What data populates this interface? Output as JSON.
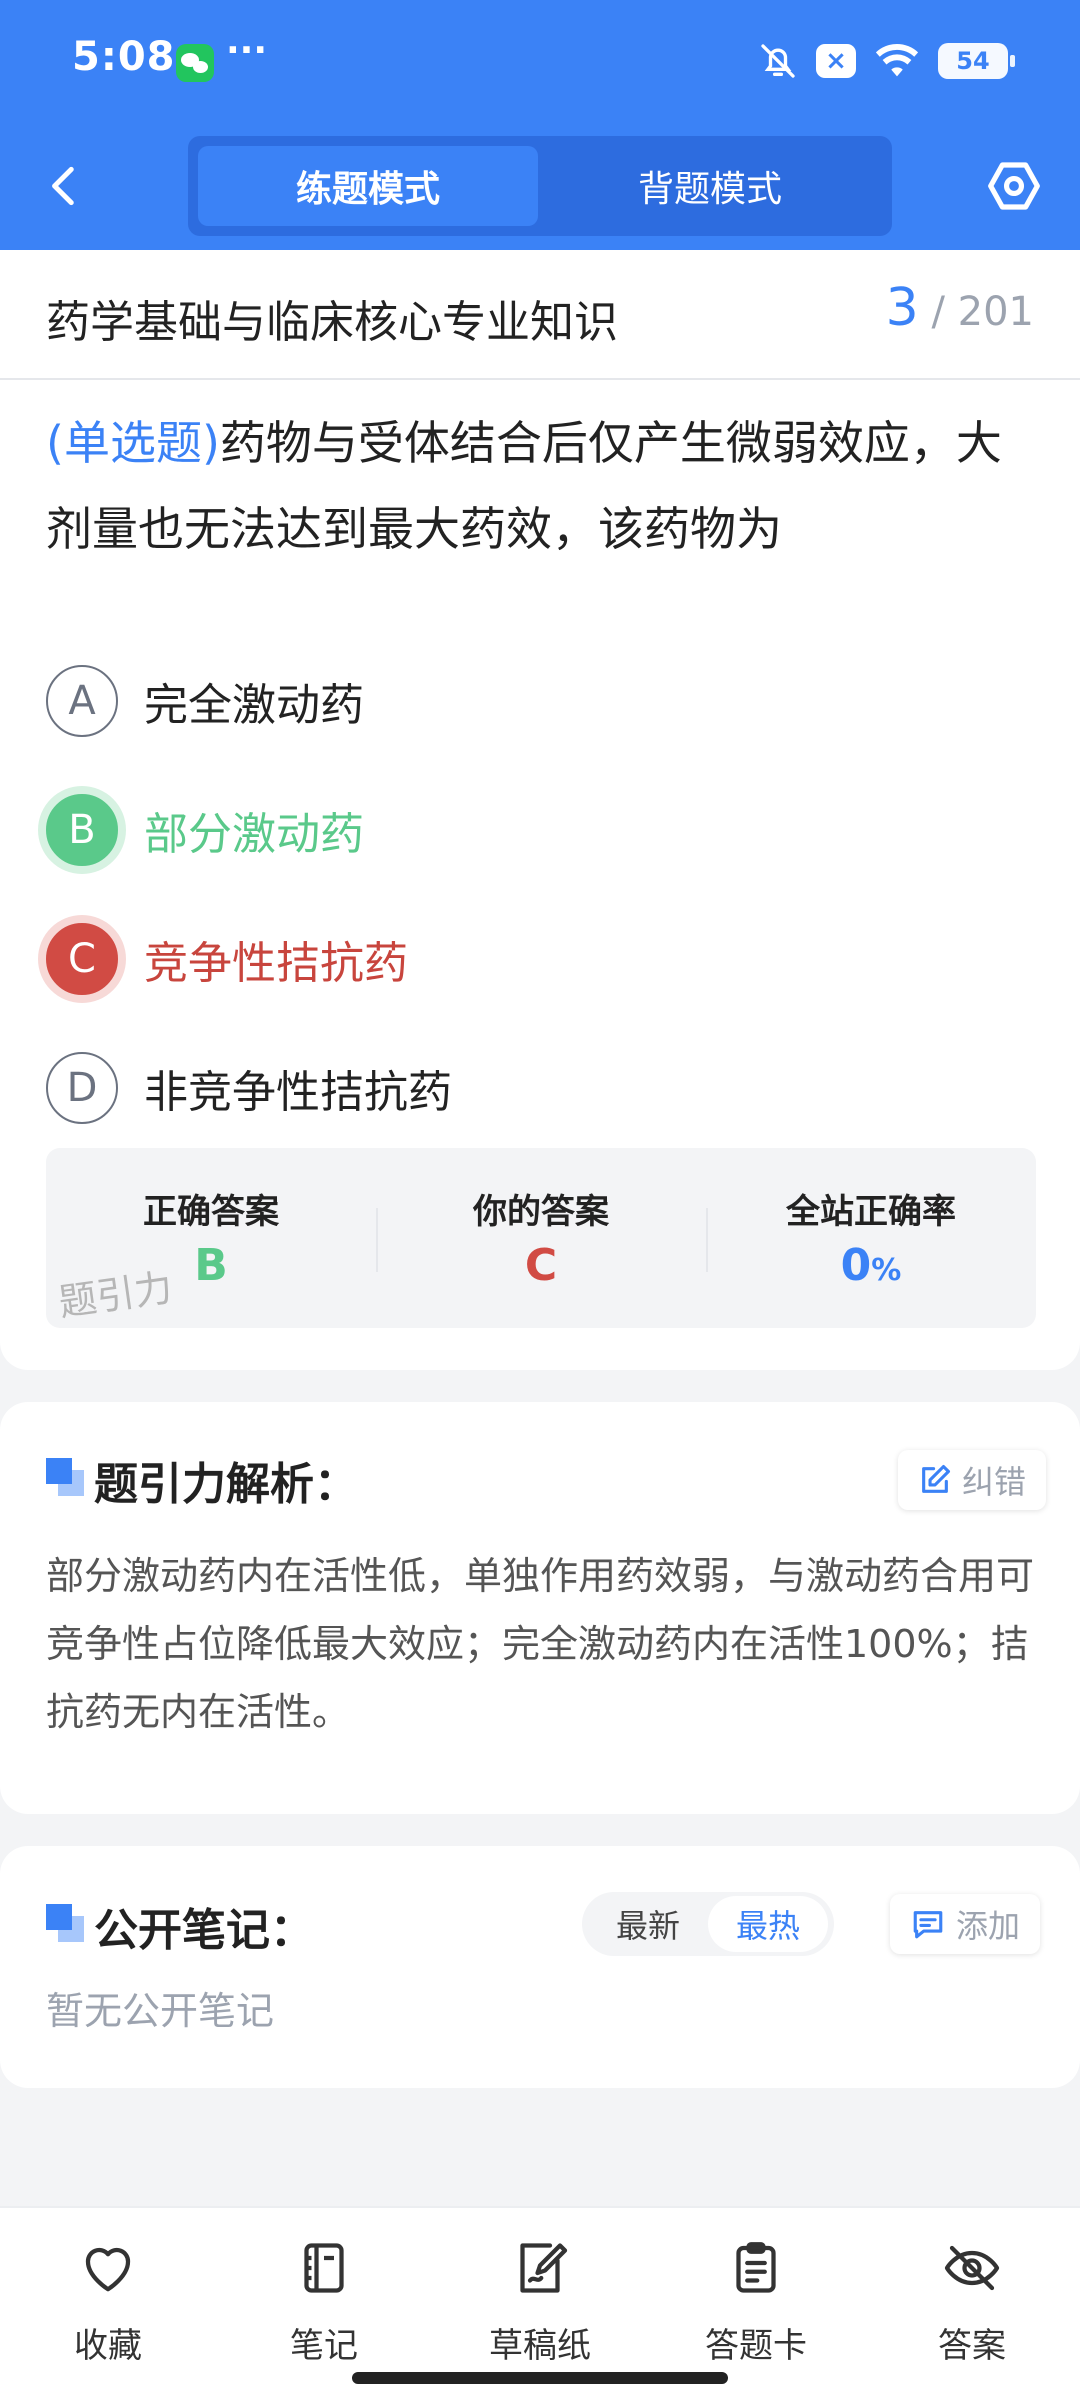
{
  "status_bar": {
    "time": "5:08",
    "more": "···",
    "battery": "54",
    "notification_x": "×"
  },
  "header": {
    "mode_tabs": [
      "练题模式",
      "背题模式"
    ],
    "active_mode": 0
  },
  "title_bar": {
    "subject": "药学基础与临床核心专业知识",
    "current": "3",
    "separator": "/",
    "total": "201"
  },
  "question": {
    "type_label": "(单选题)",
    "text": "药物与受体结合后仅产生微弱效应，大剂量也无法达到最大药效，该药物为",
    "options": [
      {
        "letter": "A",
        "text": "完全激动药",
        "state": "normal"
      },
      {
        "letter": "B",
        "text": "部分激动药",
        "state": "correct"
      },
      {
        "letter": "C",
        "text": "竞争性拮抗药",
        "state": "wrong"
      },
      {
        "letter": "D",
        "text": "非竞争性拮抗药",
        "state": "normal"
      }
    ]
  },
  "answer_summary": {
    "correct_label": "正确答案",
    "correct_value": "B",
    "yours_label": "你的答案",
    "yours_value": "C",
    "rate_label": "全站正确率",
    "rate_value": "0",
    "rate_unit": "%",
    "watermark": "题引力"
  },
  "analysis": {
    "title": "题引力解析：",
    "report_label": "纠错",
    "text": "部分激动药内在活性低，单独作用药效弱，与激动药合用可竞争性占位降低最大效应；完全激动药内在活性100%；拮抗药无内在活性。"
  },
  "notes": {
    "title": "公开笔记：",
    "sort_options": [
      "最新",
      "最热"
    ],
    "active_sort": 1,
    "add_label": "添加",
    "empty_text": "暂无公开笔记"
  },
  "bottom_nav": [
    {
      "label": "收藏",
      "icon": "heart-icon"
    },
    {
      "label": "笔记",
      "icon": "notebook-icon"
    },
    {
      "label": "草稿纸",
      "icon": "draft-icon"
    },
    {
      "label": "答题卡",
      "icon": "answer-card-icon"
    },
    {
      "label": "答案",
      "icon": "eye-off-icon"
    }
  ],
  "colors": {
    "primary": "#3b82f6",
    "correct": "#5ac98a",
    "wrong": "#d14b44"
  }
}
